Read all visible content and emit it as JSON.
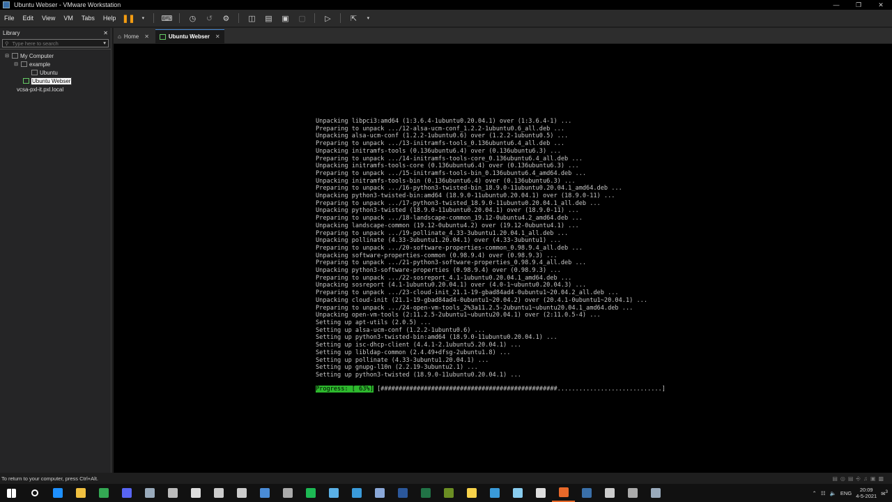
{
  "window": {
    "title": "Ubuntu Webser - VMware Workstation",
    "buttons": [
      "—",
      "❐",
      "✕"
    ]
  },
  "menu": [
    "File",
    "Edit",
    "View",
    "VM",
    "Tabs",
    "Help"
  ],
  "library": {
    "title": "Library",
    "close": "✕",
    "search_placeholder": "Type here to search",
    "tree": [
      {
        "label": "My Computer",
        "level": 0,
        "expander": "⊟"
      },
      {
        "label": "example",
        "level": 1,
        "expander": "⊟"
      },
      {
        "label": "Ubuntu",
        "level": 2,
        "expander": ""
      },
      {
        "label": "Ubuntu Webser",
        "level": 1,
        "expander": "",
        "selected": true
      },
      {
        "label": "vcsa-pxl-it.pxl.local",
        "level": 1,
        "expander": ""
      }
    ]
  },
  "tabs": [
    {
      "label": "Home",
      "close": "✕",
      "active": false
    },
    {
      "label": "Ubuntu Webser",
      "close": "✕",
      "active": true
    }
  ],
  "terminal": {
    "lines": [
      "Unpacking libpci3:amd64 (1:3.6.4-1ubuntu0.20.04.1) over (1:3.6.4-1) ...",
      "Preparing to unpack .../12-alsa-ucm-conf_1.2.2-1ubuntu0.6_all.deb ...",
      "Unpacking alsa-ucm-conf (1.2.2-1ubuntu0.6) over (1.2.2-1ubuntu0.5) ...",
      "Preparing to unpack .../13-initramfs-tools_0.136ubuntu6.4_all.deb ...",
      "Unpacking initramfs-tools (0.136ubuntu6.4) over (0.136ubuntu6.3) ...",
      "Preparing to unpack .../14-initramfs-tools-core_0.136ubuntu6.4_all.deb ...",
      "Unpacking initramfs-tools-core (0.136ubuntu6.4) over (0.136ubuntu6.3) ...",
      "Preparing to unpack .../15-initramfs-tools-bin_0.136ubuntu6.4_amd64.deb ...",
      "Unpacking initramfs-tools-bin (0.136ubuntu6.4) over (0.136ubuntu6.3) ...",
      "Preparing to unpack .../16-python3-twisted-bin_18.9.0-11ubuntu0.20.04.1_amd64.deb ...",
      "Unpacking python3-twisted-bin:amd64 (18.9.0-11ubuntu0.20.04.1) over (18.9.0-11) ...",
      "Preparing to unpack .../17-python3-twisted_18.9.0-11ubuntu0.20.04.1_all.deb ...",
      "Unpacking python3-twisted (18.9.0-11ubuntu0.20.04.1) over (18.9.0-11) ...",
      "Preparing to unpack .../18-landscape-common_19.12-0ubuntu4.2_amd64.deb ...",
      "Unpacking landscape-common (19.12-0ubuntu4.2) over (19.12-0ubuntu4.1) ...",
      "Preparing to unpack .../19-pollinate_4.33-3ubuntu1.20.04.1_all.deb ...",
      "Unpacking pollinate (4.33-3ubuntu1.20.04.1) over (4.33-3ubuntu1) ...",
      "Preparing to unpack .../20-software-properties-common_0.98.9.4_all.deb ...",
      "Unpacking software-properties-common (0.98.9.4) over (0.98.9.3) ...",
      "Preparing to unpack .../21-python3-software-properties_0.98.9.4_all.deb ...",
      "Unpacking python3-software-properties (0.98.9.4) over (0.98.9.3) ...",
      "Preparing to unpack .../22-sosreport_4.1-1ubuntu0.20.04.1_amd64.deb ...",
      "Unpacking sosreport (4.1-1ubuntu0.20.04.1) over (4.0-1~ubuntu0.20.04.3) ...",
      "Preparing to unpack .../23-cloud-init_21.1-19-gbad84ad4-0ubuntu1~20.04.2_all.deb ...",
      "Unpacking cloud-init (21.1-19-gbad84ad4-0ubuntu1~20.04.2) over (20.4.1-0ubuntu1~20.04.1) ...",
      "Preparing to unpack .../24-open-vm-tools_2%3a11.2.5-2ubuntu1~ubuntu20.04.1_amd64.deb ...",
      "Unpacking open-vm-tools (2:11.2.5-2ubuntu1~ubuntu20.04.1) over (2:11.0.5-4) ...",
      "Setting up apt-utils (2.0.5) ...",
      "Setting up alsa-ucm-conf (1.2.2-1ubuntu0.6) ...",
      "Setting up python3-twisted-bin:amd64 (18.9.0-11ubuntu0.20.04.1) ...",
      "Setting up isc-dhcp-client (4.4.1-2.1ubuntu5.20.04.1) ...",
      "Setting up libldap-common (2.4.49+dfsg-2ubuntu1.8) ...",
      "Setting up pollinate (4.33-3ubuntu1.20.04.1) ...",
      "Setting up gnupg-l10n (2.2.19-3ubuntu2.1) ...",
      "Setting up python3-twisted (18.9.0-11ubuntu0.20.04.1) ..."
    ],
    "progress_label": "Progress: [ 63%]",
    "progress_fraction": 0.63,
    "progress_bar_width": 78
  },
  "status": {
    "message": "To return to your computer, press Ctrl+Alt."
  },
  "taskbar": {
    "apps": [
      {
        "name": "start-icon",
        "color": "#ffffff"
      },
      {
        "name": "search-icon",
        "color": "#ffffff"
      },
      {
        "name": "edge-icon",
        "color": "#1e90ff"
      },
      {
        "name": "file-explorer-icon",
        "color": "#f0c040"
      },
      {
        "name": "chrome-icon",
        "color": "#34a853"
      },
      {
        "name": "discord-icon",
        "color": "#5865f2"
      },
      {
        "name": "steam-icon",
        "color": "#9ab"
      },
      {
        "name": "app-cube-icon",
        "color": "#bbbbbb"
      },
      {
        "name": "obs-icon",
        "color": "#dddddd"
      },
      {
        "name": "app-icon-9",
        "color": "#cccccc"
      },
      {
        "name": "app-icon-10",
        "color": "#cccccc"
      },
      {
        "name": "calculator-icon",
        "color": "#4a8cd6"
      },
      {
        "name": "app-icon-12",
        "color": "#aaaaaa"
      },
      {
        "name": "green-app-icon",
        "color": "#1db954"
      },
      {
        "name": "app-icon-14",
        "color": "#5ab0e6"
      },
      {
        "name": "app-icon-15",
        "color": "#3a9ad9"
      },
      {
        "name": "notepad-icon",
        "color": "#8aa8d8"
      },
      {
        "name": "word-icon",
        "color": "#2b579a"
      },
      {
        "name": "excel-icon",
        "color": "#217346"
      },
      {
        "name": "minecraft-icon",
        "color": "#6b8e23"
      },
      {
        "name": "sticky-notes-icon",
        "color": "#f7d24a"
      },
      {
        "name": "mail-icon",
        "color": "#3a9ad9"
      },
      {
        "name": "app-icon-22",
        "color": "#88ccee"
      },
      {
        "name": "app-cube-icon-2",
        "color": "#dddddd"
      },
      {
        "name": "vmware-icon",
        "color": "#e8692a",
        "active": true
      },
      {
        "name": "app-icon-25",
        "color": "#3a6fa8"
      },
      {
        "name": "app-icon-26",
        "color": "#cccccc"
      },
      {
        "name": "app-icon-27",
        "color": "#aaaaaa"
      },
      {
        "name": "steam-icon-2",
        "color": "#9ab"
      }
    ],
    "tray": {
      "language": "ENG",
      "time": "20:09",
      "date": "4-5-2021",
      "notifications": "3"
    }
  }
}
